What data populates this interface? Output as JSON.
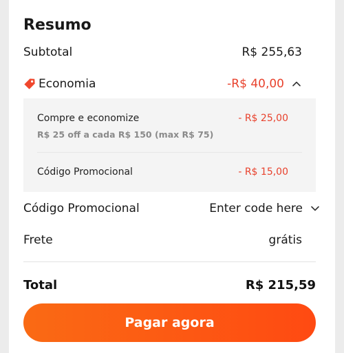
{
  "summary": {
    "title": "Resumo",
    "subtotal": {
      "label": "Subtotal",
      "value": "R$ 255,63"
    },
    "savings": {
      "label": "Economia",
      "value": "-R$ 40,00",
      "icon": "tag-icon",
      "toggle_icon": "chevron-up-icon"
    },
    "breakdown": [
      {
        "label": "Compre e economize",
        "detail": "R$ 25 off a cada R$ 150 (max R$ 75)",
        "value": "- R$ 25,00"
      },
      {
        "label": "Código Promocional",
        "value": "- R$ 15,00"
      }
    ],
    "promo": {
      "label": "Código Promocional",
      "placeholder": "Enter code here",
      "toggle_icon": "chevron-down-icon"
    },
    "shipping": {
      "label": "Frete",
      "value": "grátis"
    },
    "total": {
      "label": "Total",
      "value": "R$ 215,59"
    },
    "pay_button": "Pagar agora"
  },
  "colors": {
    "accent": "#ff5a12",
    "discount": "#e8412c"
  }
}
